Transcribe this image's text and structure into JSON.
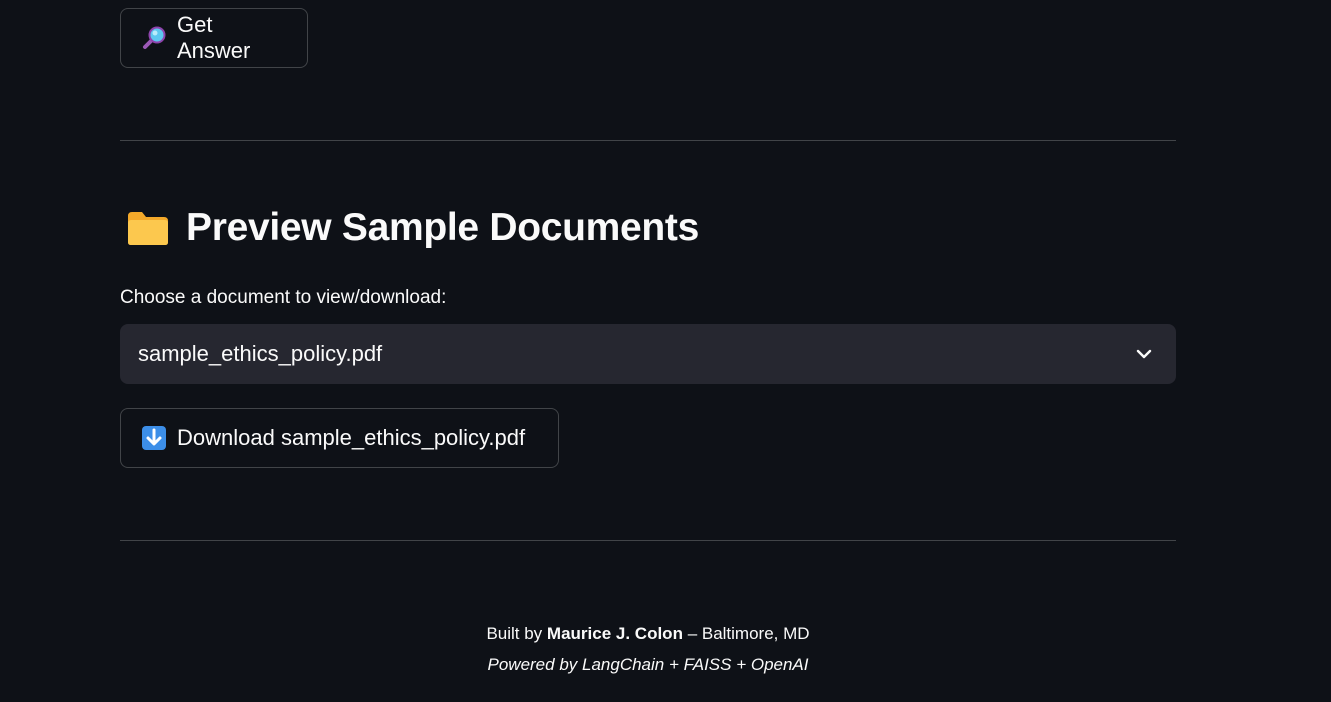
{
  "get_answer_button": {
    "label": "Get Answer",
    "icon": "magnifying-glass-icon"
  },
  "preview_section": {
    "title": "Preview Sample Documents",
    "icon": "folder-icon",
    "select_label": "Choose a document to view/download:",
    "selected_document": "sample_ethics_policy.pdf",
    "download_button": {
      "label": "Download sample_ethics_policy.pdf",
      "icon": "down-arrow-icon"
    }
  },
  "footer": {
    "built_by_prefix": "Built by",
    "author": "Maurice J. Colon",
    "location_suffix": "– Baltimore, MD",
    "powered_by": "Powered by LangChain + FAISS + OpenAI"
  },
  "colors": {
    "background": "#0e1117",
    "select_background": "#262730",
    "text": "#fafafa",
    "folder": "#f9b83c",
    "download_icon": "#3c8ee8"
  }
}
